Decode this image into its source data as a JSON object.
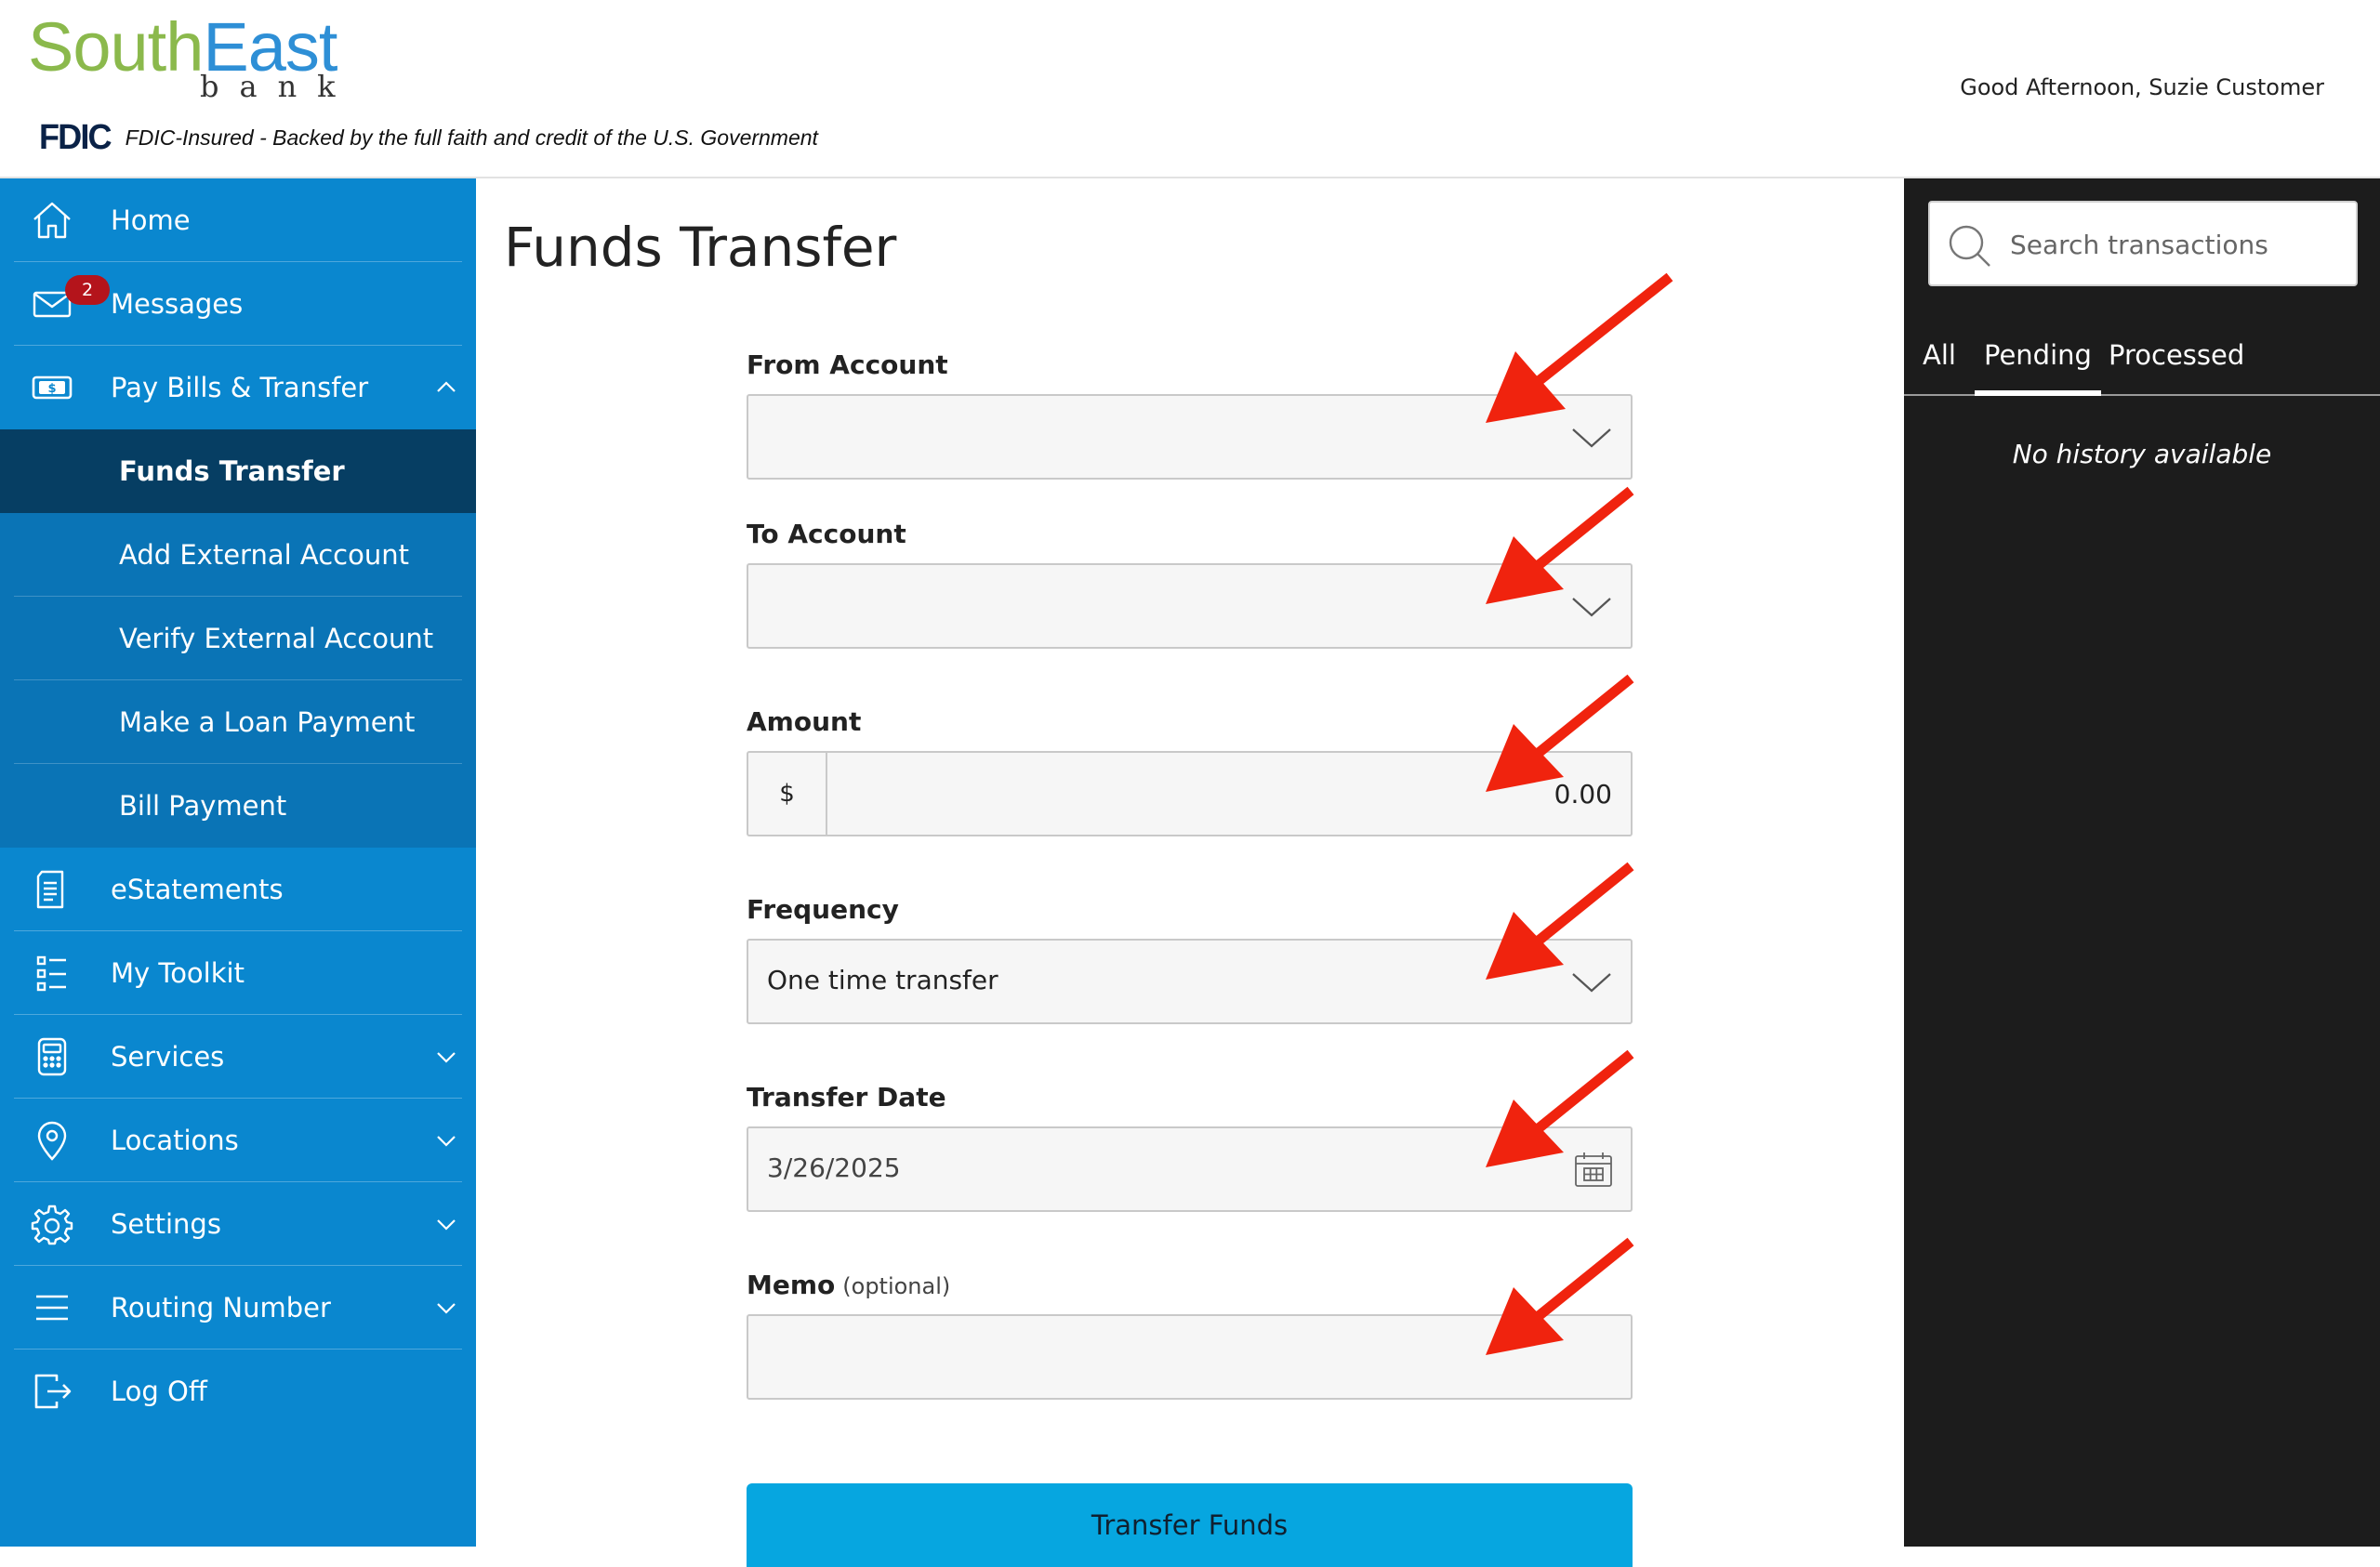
{
  "header": {
    "logo_south": "South",
    "logo_east": "East",
    "logo_bank": "bank",
    "fdic_mark": "FDIC",
    "fdic_text": "FDIC-Insured - Backed by the full faith and credit of the U.S. Government",
    "greeting": "Good Afternoon, Suzie Customer"
  },
  "sidebar": {
    "items": [
      {
        "label": "Home",
        "icon": "home-icon"
      },
      {
        "label": "Messages",
        "icon": "mail-icon",
        "badge": "2"
      },
      {
        "label": "Pay Bills & Transfer",
        "icon": "money-icon",
        "expanded": true
      },
      {
        "label": "eStatements",
        "icon": "document-icon"
      },
      {
        "label": "My Toolkit",
        "icon": "list-icon"
      },
      {
        "label": "Services",
        "icon": "calculator-icon"
      },
      {
        "label": "Locations",
        "icon": "location-pin-icon"
      },
      {
        "label": "Settings",
        "icon": "gear-icon"
      },
      {
        "label": "Routing Number",
        "icon": "menu-lines-icon"
      },
      {
        "label": "Log Off",
        "icon": "logout-icon"
      }
    ],
    "subitems": [
      {
        "label": "Funds Transfer",
        "active": true
      },
      {
        "label": "Add External Account"
      },
      {
        "label": "Verify External Account"
      },
      {
        "label": "Make a Loan Payment"
      },
      {
        "label": "Bill Payment"
      }
    ]
  },
  "main": {
    "title": "Funds Transfer",
    "from_account": {
      "label": "From Account",
      "value": ""
    },
    "to_account": {
      "label": "To Account",
      "value": ""
    },
    "amount": {
      "label": "Amount",
      "currency": "$",
      "value": "0.00"
    },
    "frequency": {
      "label": "Frequency",
      "value": "One time transfer"
    },
    "transfer_date": {
      "label": "Transfer Date",
      "value": "3/26/2025"
    },
    "memo": {
      "label": "Memo",
      "optional": "(optional)",
      "value": ""
    },
    "submit_label": "Transfer Funds"
  },
  "history": {
    "search_placeholder": "Search transactions",
    "tabs": [
      {
        "label": "All"
      },
      {
        "label": "Pending",
        "active": true
      },
      {
        "label": "Processed"
      }
    ],
    "empty_text": "No history available"
  },
  "colors": {
    "sidebar": "#0a87cf",
    "sidebar_sub": "#0a74b6",
    "sidebar_active": "#063e63",
    "button": "#06a6e0",
    "annotation_arrow": "#f0230e",
    "right_panel": "#1c1c1c"
  }
}
